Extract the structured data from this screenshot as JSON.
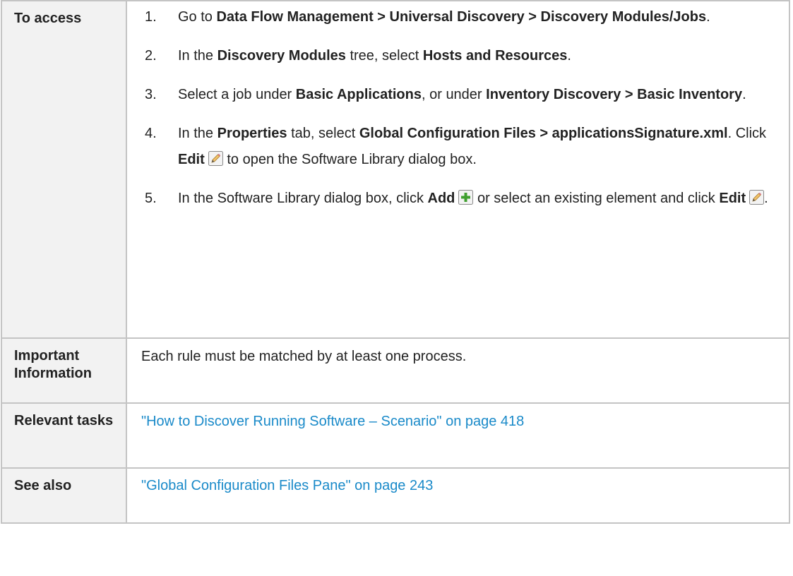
{
  "rows": {
    "access": {
      "label": "To access",
      "steps": [
        {
          "num": "1.",
          "t1": "Go to ",
          "b1": "Data Flow Management > Universal Discovery > Discovery Modules/Jobs",
          "t2": "."
        },
        {
          "num": "2.",
          "t1": "In the ",
          "b1": "Discovery Modules",
          "t2": " tree, select ",
          "b2": "Hosts and Resources",
          "t3": "."
        },
        {
          "num": "3.",
          "t1": "Select a job under ",
          "b1": "Basic Applications",
          "t2": ", or under ",
          "b2": "Inventory Discovery > Basic Inventory",
          "t3": "."
        },
        {
          "num": "4.",
          "t1": "In the ",
          "b1": "Properties",
          "t2": " tab, select ",
          "b2": "Global Configuration Files > applicationsSignature.xml",
          "t3": ". Click ",
          "b3": "Edit",
          "icon1": "edit-pencil-icon",
          "t4": " to open the Software Library dialog box."
        },
        {
          "num": "5.",
          "t1": "In the Software Library dialog box, click ",
          "b1": "Add",
          "icon1": "add-plus-icon",
          "t2": " or select an existing element and click ",
          "b2": "Edit",
          "icon2": "edit-pencil-icon",
          "t3": "."
        }
      ]
    },
    "info": {
      "label": "Important Information",
      "text": "Each rule must be matched by at least one process."
    },
    "tasks": {
      "label": "Relevant tasks",
      "link": "\"How to Discover Running Software – Scenario\" on page 418"
    },
    "see_also": {
      "label": "See also",
      "link": "\"Global Configuration Files Pane\" on page 243"
    }
  },
  "colors": {
    "label_background": "#f2f2f2",
    "border": "#c4c4c4",
    "link": "#1a8ac9"
  }
}
